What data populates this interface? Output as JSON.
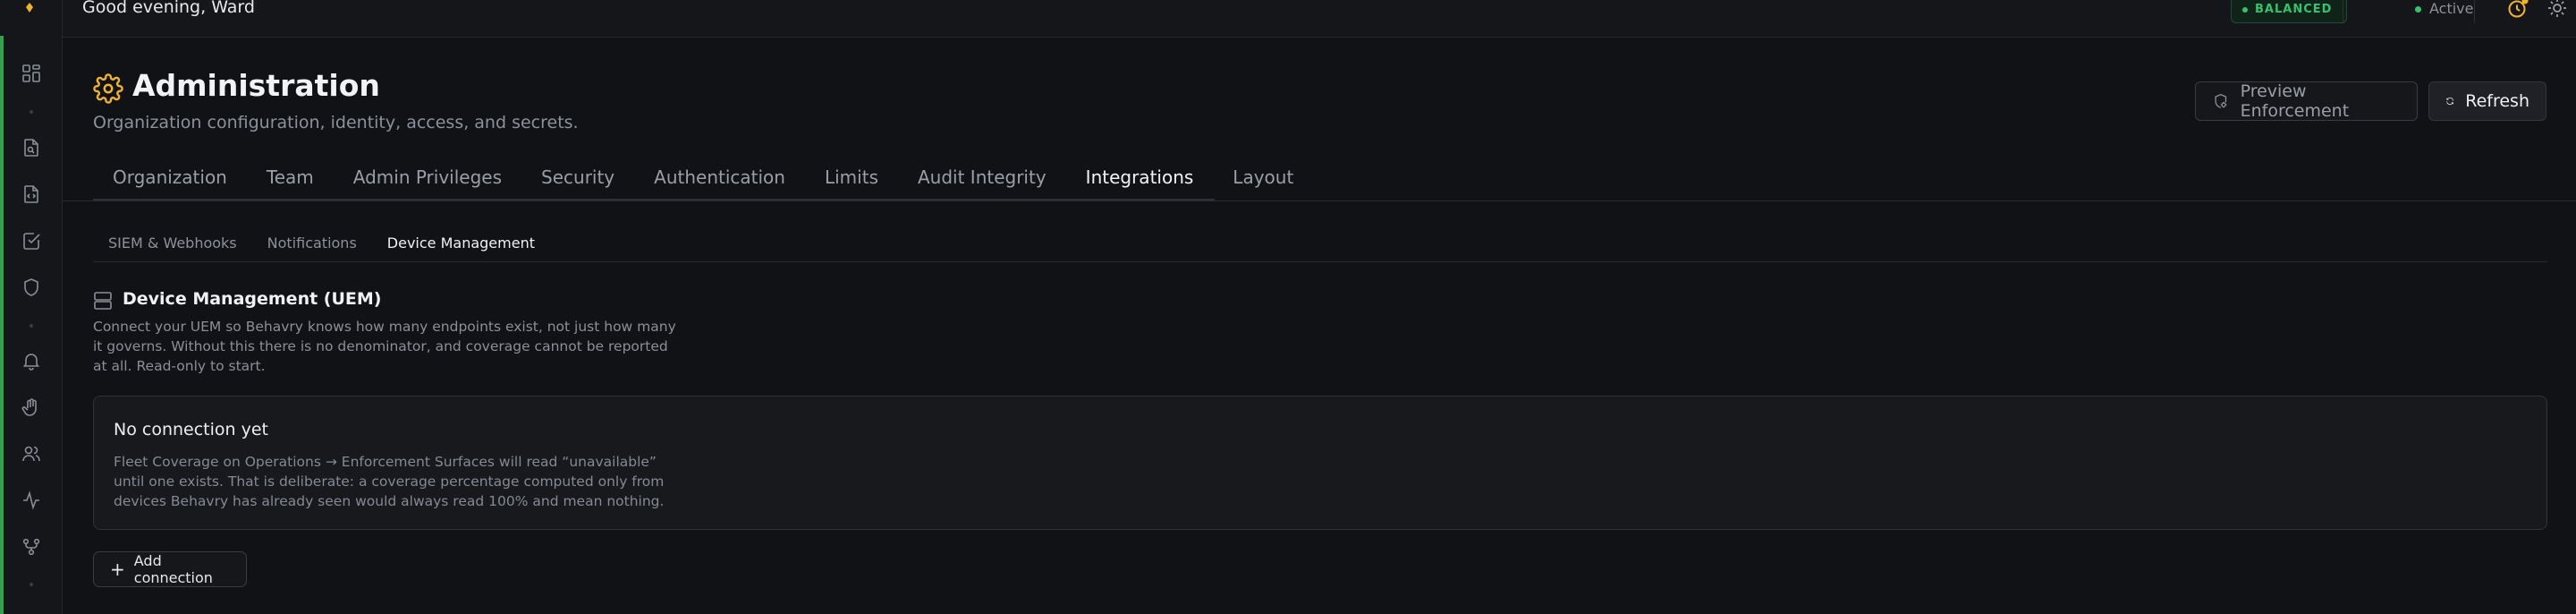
{
  "topbar": {
    "greeting": "Good evening, Ward",
    "mode_badge": "BALANCED",
    "status": "Active",
    "icons": [
      "clock-icon",
      "sun-icon",
      "logout-icon"
    ]
  },
  "colors": {
    "accent": "#f0b429",
    "success": "#34c26f",
    "background": "#111215"
  },
  "header": {
    "title": "Administration",
    "subtitle": "Organization configuration, identity, access, and secrets.",
    "preview_label": "Preview Enforcement",
    "refresh_label": "Refresh"
  },
  "tabs": [
    {
      "label": "Organization"
    },
    {
      "label": "Team"
    },
    {
      "label": "Admin Privileges"
    },
    {
      "label": "Security"
    },
    {
      "label": "Authentication"
    },
    {
      "label": "Limits"
    },
    {
      "label": "Audit Integrity"
    },
    {
      "label": "Integrations",
      "active": true
    },
    {
      "label": "Layout"
    }
  ],
  "subtabs": [
    {
      "label": "SIEM & Webhooks"
    },
    {
      "label": "Notifications"
    },
    {
      "label": "Device Management",
      "active": true
    }
  ],
  "section": {
    "title": "Device Management (UEM)",
    "description": "Connect your UEM so Behavry knows how many endpoints exist, not just how many it governs. Without this there is no denominator, and coverage cannot be reported at all. Read-only to start."
  },
  "empty_state": {
    "title": "No connection yet",
    "text": "Fleet Coverage on Operations → Enforcement Surfaces will read “unavailable” until one exists. That is deliberate: a coverage percentage computed only from devices Behavry has already seen would always read 100% and mean nothing."
  },
  "add_button": "Add connection",
  "rail_icons": [
    "dashboard-icon",
    "document-search-icon",
    "code-file-icon",
    "checklist-icon",
    "shield-icon",
    "bell-icon",
    "hand-icon",
    "users-icon",
    "activity-icon",
    "git-branch-icon"
  ]
}
